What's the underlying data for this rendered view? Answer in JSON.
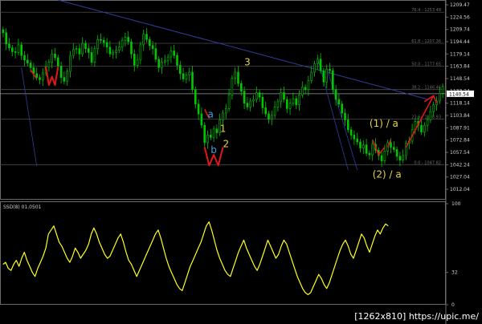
{
  "chart_data": {
    "type": "candlestick",
    "price_panel": {
      "y_axis_labels": [
        "1209.47",
        "1224.56",
        "1209.74",
        "1194.44",
        "1179.14",
        "1163.84",
        "1148.54",
        "1133.24",
        "1118.14",
        "1103.84",
        "1087.91",
        "1072.84",
        "1057.54",
        "1042.24",
        "1027.04",
        "1012.04"
      ],
      "current_price_label": "1140.54",
      "close_series": [
        1221,
        1206,
        1201,
        1196,
        1195,
        1205,
        1191,
        1185,
        1181,
        1175,
        1167,
        1162,
        1159,
        1168,
        1176,
        1182,
        1193,
        1188,
        1177,
        1162,
        1157,
        1170,
        1191,
        1199,
        1200,
        1193,
        1207,
        1200,
        1195,
        1182,
        1200,
        1212,
        1211,
        1208,
        1202,
        1193,
        1195,
        1198,
        1202,
        1211,
        1215,
        1209,
        1193,
        1178,
        1185,
        1205,
        1219,
        1212,
        1204,
        1200,
        1186,
        1175,
        1182,
        1184,
        1189,
        1197,
        1191,
        1178,
        1167,
        1160,
        1165,
        1169,
        1146,
        1127,
        1114,
        1099,
        1076,
        1086,
        1083,
        1094,
        1089,
        1106,
        1115,
        1121,
        1139,
        1161,
        1169,
        1154,
        1144,
        1128,
        1123,
        1131,
        1133,
        1142,
        1136,
        1122,
        1114,
        1107,
        1112,
        1123,
        1130,
        1142,
        1133,
        1121,
        1128,
        1134,
        1126,
        1139,
        1149,
        1146,
        1158,
        1169,
        1180,
        1186,
        1171,
        1156,
        1173,
        1171,
        1146,
        1133,
        1127,
        1115,
        1106,
        1093,
        1086,
        1081,
        1077,
        1069,
        1073,
        1062,
        1060,
        1074,
        1066,
        1059,
        1052,
        1065,
        1076,
        1070,
        1067,
        1058,
        1053,
        1059,
        1075,
        1078,
        1093,
        1104,
        1099,
        1090,
        1099,
        1106,
        1117,
        1126,
        1131,
        1141,
        1150
      ],
      "fib_levels": [
        {
          "price": 1248,
          "label": "76.4 - 1253.48"
        },
        {
          "price": 1207,
          "label": "61.8 - 1207.36"
        },
        {
          "price": 1177,
          "label": "50.0 - 1177.65"
        },
        {
          "price": 1146,
          "label": "38.2 - 1146.46"
        },
        {
          "price": 1107,
          "label": "23.6 - 1108.93"
        },
        {
          "price": 1047,
          "label": "0.0 - 1047.82"
        }
      ],
      "wave_labels": [
        {
          "text": "3",
          "price": 1178,
          "bar": 79,
          "color": "yellow"
        },
        {
          "text": "a",
          "price": 1109,
          "bar": 67,
          "color": "blue"
        },
        {
          "text": "1",
          "price": 1090,
          "bar": 71,
          "color": "yellow"
        },
        {
          "text": "b",
          "price": 1062,
          "bar": 68,
          "color": "blue"
        },
        {
          "text": "2",
          "price": 1070,
          "bar": 72,
          "color": "yellow"
        },
        {
          "text": "(1) / a",
          "price": 1097,
          "bar": 120,
          "color": "yellow"
        },
        {
          "text": "(2) / a",
          "price": 1030,
          "bar": 121,
          "color": "yellow"
        }
      ]
    },
    "indicator_panel": {
      "label": "SSD(8) 01.0501",
      "y_axis_labels": [
        "100",
        "32",
        "0"
      ],
      "ylim": [
        0,
        100
      ],
      "values": [
        40,
        42,
        36,
        34,
        40,
        44,
        38,
        46,
        52,
        44,
        38,
        32,
        28,
        36,
        42,
        48,
        56,
        70,
        74,
        78,
        70,
        62,
        58,
        52,
        46,
        42,
        48,
        56,
        52,
        46,
        50,
        54,
        60,
        70,
        76,
        70,
        62,
        56,
        50,
        46,
        48,
        54,
        60,
        66,
        70,
        62,
        52,
        44,
        40,
        34,
        28,
        34,
        40,
        46,
        52,
        58,
        64,
        70,
        74,
        66,
        56,
        46,
        38,
        32,
        26,
        20,
        16,
        14,
        22,
        30,
        38,
        44,
        50,
        56,
        62,
        70,
        78,
        82,
        74,
        64,
        54,
        46,
        40,
        34,
        30,
        28,
        36,
        44,
        52,
        58,
        64,
        56,
        50,
        44,
        38,
        34,
        40,
        48,
        56,
        64,
        58,
        52,
        46,
        50,
        58,
        64,
        60,
        52,
        44,
        36,
        28,
        22,
        16,
        12,
        10,
        12,
        18,
        24,
        30,
        26,
        20,
        16,
        22,
        30,
        38,
        46,
        54,
        60,
        64,
        58,
        50,
        46,
        54,
        62,
        70,
        66,
        58,
        52,
        60,
        68,
        74,
        70,
        76,
        80,
        78
      ]
    }
  },
  "watermark": "[1262x810] https://upic.me/"
}
